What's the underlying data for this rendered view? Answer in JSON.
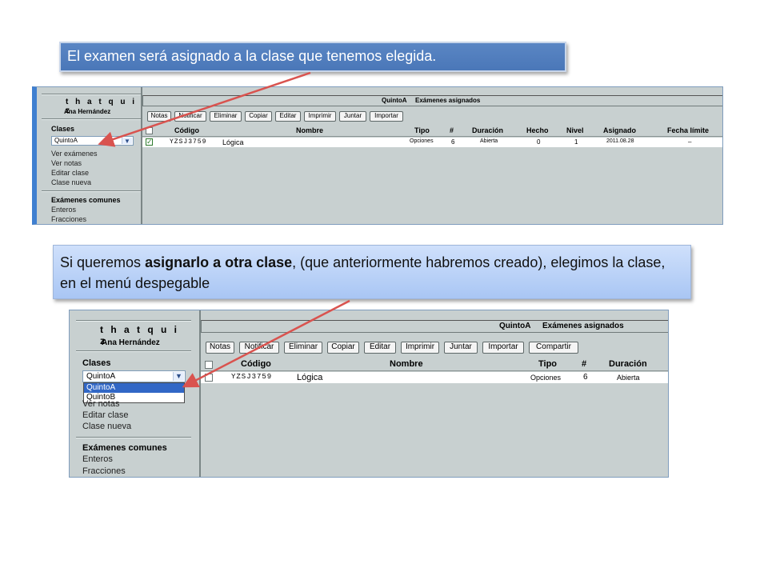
{
  "callouts": {
    "first": "El examen será asignado a la clase que tenemos elegida.",
    "second_pre": "Si queremos ",
    "second_bold": "asignarlo a otra clase",
    "second_post": ", (que anteriormente habremos creado), elegimos la clase, en el menú despegable"
  },
  "app": {
    "logo": "t h a t q u i z",
    "user": "Ana Hernández",
    "classes_label": "Clases",
    "selected_class": "QuintoA",
    "class_options": [
      "QuintoA",
      "QuintoB"
    ],
    "links": [
      "Ver exámenes",
      "Ver notas",
      "Editar clase",
      "Clase nueva"
    ],
    "common_label": "Exámenes comunes",
    "common_links": [
      "Enteros",
      "Fracciones"
    ],
    "title_class": "QuintoA",
    "title_text": "Exámenes asignados",
    "buttons": [
      "Notas",
      "Notificar",
      "Eliminar",
      "Copiar",
      "Editar",
      "Imprimir",
      "Juntar",
      "Importar",
      "Compartir"
    ],
    "columns": [
      "Código",
      "Nombre",
      "Tipo",
      "#",
      "Duración",
      "Hecho",
      "Nivel",
      "Asignado",
      "Fecha límite"
    ],
    "row": {
      "code": "YZSJ3759",
      "name": "Lógica",
      "type": "Opciones",
      "count": "6",
      "duration": "Abierta",
      "done": "0",
      "level": "1",
      "assigned": "2011.08.28",
      "deadline": "–"
    },
    "second_links": [
      "Ver notas",
      "Editar clase",
      "Clase nueva"
    ]
  },
  "colors": {
    "callout_blue": "#4a77b8",
    "callout_light": "#b9d1f7",
    "arrow_red": "#d9534f",
    "app_gray": "#c8d0d0",
    "highlight": "#3167c6"
  }
}
